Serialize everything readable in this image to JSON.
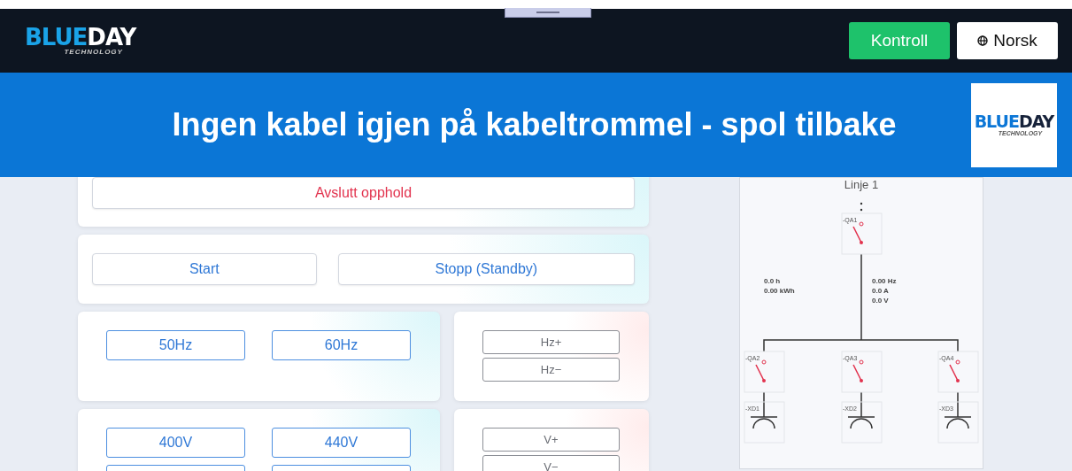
{
  "header": {
    "logo": {
      "blue": "BLUE",
      "dark": "DAY",
      "tagline": "TECHNOLOGY"
    },
    "buttons": [
      {
        "label": "Kontroll",
        "kind": "primary"
      },
      {
        "label": "Norsk",
        "kind": "language"
      }
    ]
  },
  "banner": {
    "title": "Ingen kabel igjen på kabeltrommel - spol tilbake",
    "logo": {
      "blue": "BLUE",
      "dark": "DAY",
      "tagline": "TECHNOLOGY"
    }
  },
  "cards": [
    {
      "kind": "wide",
      "buttons": [
        {
          "label": "Avslutt opphold",
          "kind": "danger"
        }
      ]
    },
    {
      "kind": "wide",
      "buttons": [
        {
          "label": "Start",
          "kind": "action"
        },
        {
          "label": "Stopp (Standby)",
          "kind": "action"
        }
      ]
    },
    {
      "kind": "pair",
      "presets": [
        "50Hz",
        "60Hz"
      ],
      "adjust": [
        "Hz+",
        "Hz−"
      ],
      "more_presets": false
    },
    {
      "kind": "pair",
      "presets": [
        "400V",
        "440V"
      ],
      "adjust": [
        "V+",
        "V−"
      ],
      "more_presets": true
    }
  ],
  "diagram": {
    "title": "Linje 1",
    "main_switch": "-QA1",
    "left_readings": [
      "0.0 h",
      "0.00 kWh"
    ],
    "right_readings": [
      "0.00 Hz",
      "0.0 A",
      "0.0 V"
    ],
    "branches": [
      {
        "switch": "-QA2",
        "outlet": "-XD1"
      },
      {
        "switch": "-QA3",
        "outlet": "-XD2"
      },
      {
        "switch": "-QA4",
        "outlet": "-XD3"
      }
    ]
  }
}
